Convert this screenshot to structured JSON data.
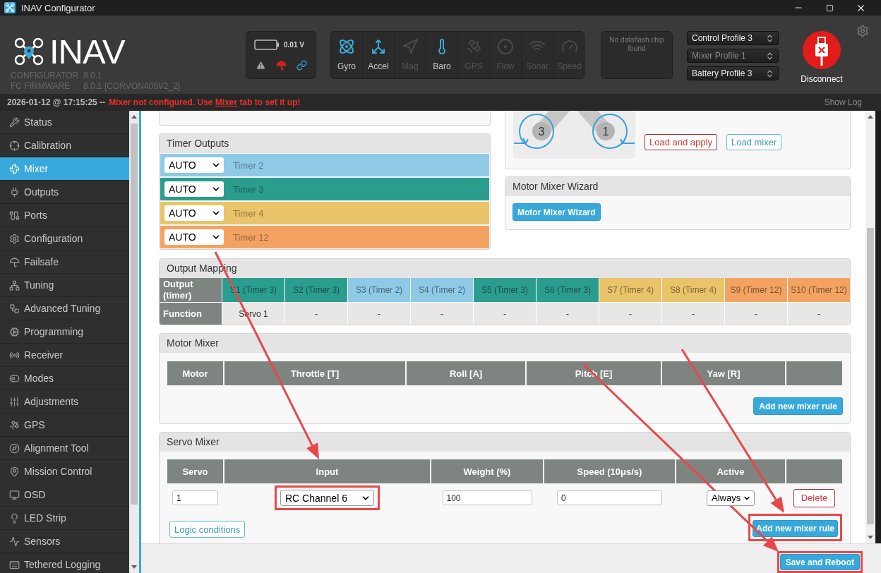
{
  "window": {
    "title": "INAV Configurator"
  },
  "header": {
    "logo_text": "INAV",
    "versions": [
      {
        "label": "CONFIGURATOR",
        "value": "8.0.1"
      },
      {
        "label": "FC FIRMWARE",
        "value": "8.0.1 [CORVON405V2_2]"
      }
    ],
    "battery": {
      "voltage": "0.01 V"
    },
    "sensors": [
      {
        "label": "Gyro",
        "active": true
      },
      {
        "label": "Accel",
        "active": true
      },
      {
        "label": "Mag",
        "active": false
      },
      {
        "label": "Baro",
        "active": true
      },
      {
        "label": "GPS",
        "active": false
      },
      {
        "label": "Flow",
        "active": false
      },
      {
        "label": "Sonar",
        "active": false
      },
      {
        "label": "Speed",
        "active": false
      }
    ],
    "dataflash": "No dataflash chip found",
    "profiles": [
      {
        "label": "Control Profile 3",
        "disabled": false
      },
      {
        "label": "Mixer Profile 1",
        "disabled": true
      },
      {
        "label": "Battery Profile 3",
        "disabled": false
      }
    ],
    "connect_button": "Disconnect"
  },
  "status_bar": {
    "timestamp": "2026-01-12 @ 17:15:25 --",
    "message": {
      "before": "Mixer not configured. Use",
      "link": "Mixer",
      "after": "tab to set it up!"
    },
    "show_log": "Show Log"
  },
  "sidebar": {
    "items": [
      {
        "label": "Status",
        "selected": false
      },
      {
        "label": "Calibration",
        "selected": false
      },
      {
        "label": "Mixer",
        "selected": true
      },
      {
        "label": "Outputs",
        "selected": false
      },
      {
        "label": "Ports",
        "selected": false
      },
      {
        "label": "Configuration",
        "selected": false
      },
      {
        "label": "Failsafe",
        "selected": false
      },
      {
        "label": "Tuning",
        "selected": false
      },
      {
        "label": "Advanced Tuning",
        "selected": false
      },
      {
        "label": "Programming",
        "selected": false
      },
      {
        "label": "Receiver",
        "selected": false
      },
      {
        "label": "Modes",
        "selected": false
      },
      {
        "label": "Adjustments",
        "selected": false
      },
      {
        "label": "GPS",
        "selected": false
      },
      {
        "label": "Alignment Tool",
        "selected": false
      },
      {
        "label": "Mission Control",
        "selected": false
      },
      {
        "label": "OSD",
        "selected": false
      },
      {
        "label": "LED Strip",
        "selected": false
      },
      {
        "label": "Sensors",
        "selected": false
      },
      {
        "label": "Tethered Logging",
        "selected": false
      }
    ]
  },
  "timer_outputs": {
    "title": "Timer Outputs",
    "rows": [
      {
        "mode": "AUTO",
        "label": "Timer 2",
        "color": "#8ecae6"
      },
      {
        "mode": "AUTO",
        "label": "Timer 3",
        "color": "#2a9d8f"
      },
      {
        "mode": "AUTO",
        "label": "Timer 4",
        "color": "#e9c46a"
      },
      {
        "mode": "AUTO",
        "label": "Timer 12",
        "color": "#f4a261"
      }
    ]
  },
  "mixer_preview": {
    "motors": [
      "3",
      "1"
    ],
    "buttons": [
      {
        "label": "Load and apply",
        "kind": "danger"
      },
      {
        "label": "Load mixer",
        "kind": "outline"
      }
    ]
  },
  "motor_mixer_wizard": {
    "title": "Motor Mixer Wizard",
    "button": "Motor Mixer Wizard"
  },
  "output_mapping": {
    "title": "Output Mapping",
    "row_headers": [
      "Output (timer)",
      "Function"
    ],
    "outputs": [
      {
        "label": "S1 (Timer 3)",
        "function": "Servo 1",
        "color": "#2a9d8f"
      },
      {
        "label": "S2 (Timer 3)",
        "function": "-",
        "color": "#2a9d8f"
      },
      {
        "label": "S3 (Timer 2)",
        "function": "-",
        "color": "#8ecae6"
      },
      {
        "label": "S4 (Timer 2)",
        "function": "-",
        "color": "#8ecae6"
      },
      {
        "label": "S5 (Timer 3)",
        "function": "-",
        "color": "#2a9d8f"
      },
      {
        "label": "S6 (Timer 3)",
        "function": "-",
        "color": "#2a9d8f"
      },
      {
        "label": "S7 (Timer 4)",
        "function": "-",
        "color": "#e9c46a"
      },
      {
        "label": "S8 (Timer 4)",
        "function": "-",
        "color": "#e9c46a"
      },
      {
        "label": "S9 (Timer 12)",
        "function": "-",
        "color": "#f4a261"
      },
      {
        "label": "S10 (Timer 12)",
        "function": "-",
        "color": "#f4a261"
      }
    ]
  },
  "motor_mixer": {
    "title": "Motor Mixer",
    "columns": [
      "Motor",
      "Throttle [T]",
      "Roll [A]",
      "Pitch [E]",
      "Yaw [R]"
    ],
    "add_button": "Add new mixer rule"
  },
  "servo_mixer": {
    "title": "Servo Mixer",
    "columns": [
      "Servo",
      "Input",
      "Weight (%)",
      "Speed (10μs/s)",
      "Active"
    ],
    "rows": [
      {
        "servo": "1",
        "input": {
          "value": "RC Channel 6",
          "highlighted": true
        },
        "weight": "100",
        "speed": "0",
        "active": "Always",
        "delete_button": "Delete"
      }
    ],
    "buttons": [
      {
        "label": "Logic conditions",
        "kind": "outline",
        "highlighted": false
      },
      {
        "label": "Add new mixer rule",
        "kind": "primary",
        "highlighted": true
      }
    ]
  },
  "footer": {
    "save_button": {
      "label": "Save and Reboot",
      "highlighted": true
    }
  }
}
